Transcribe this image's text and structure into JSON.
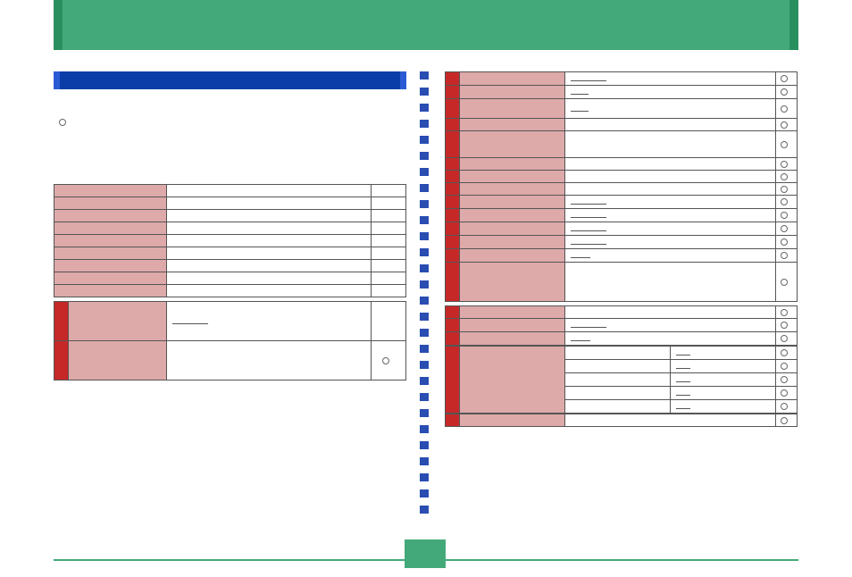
{
  "header": {
    "title": ""
  },
  "left": {
    "intro_line1": "",
    "intro_line2": "",
    "bullet_label": "",
    "footnote": "",
    "table_title": "",
    "table1": {
      "cols": [
        "",
        "",
        ""
      ],
      "rows": [
        {
          "c1": "",
          "c2": "",
          "c3": ""
        },
        {
          "c1": "",
          "c2": "",
          "c3": ""
        },
        {
          "c1": "",
          "c2": "",
          "c3": ""
        },
        {
          "c1": "",
          "c2": "",
          "c3": ""
        },
        {
          "c1": "",
          "c2": "",
          "c3": ""
        },
        {
          "c1": "",
          "c2": "",
          "c3": ""
        },
        {
          "c1": "",
          "c2": "",
          "c3": ""
        },
        {
          "c1": "",
          "c2": "",
          "c3": ""
        },
        {
          "c1": "",
          "c2": "",
          "c3": ""
        }
      ]
    },
    "table2": {
      "row_a_label": "",
      "row_a_text": "",
      "row_b_label": "",
      "row_b_text": ""
    }
  },
  "right": {
    "tall_table": {
      "rows": [
        {
          "label": "",
          "text": "",
          "has_radio": true
        },
        {
          "label": "",
          "text": "",
          "has_radio": true
        },
        {
          "label": "",
          "text": "",
          "has_radio": true
        },
        {
          "label": "",
          "text": "",
          "has_radio": true
        },
        {
          "label": "",
          "text": "",
          "has_radio": true
        },
        {
          "label": "",
          "text": "",
          "has_radio": true
        },
        {
          "label": "",
          "text": "",
          "has_radio": true
        },
        {
          "label": "",
          "text": "",
          "has_radio": true
        },
        {
          "label": "",
          "text": "",
          "has_radio": true
        },
        {
          "label": "",
          "text": "",
          "has_radio": true
        },
        {
          "label": "",
          "text": "",
          "has_radio": true
        },
        {
          "label": "",
          "text": "",
          "has_radio": true
        },
        {
          "label": "",
          "text": "",
          "has_radio": true
        },
        {
          "label": "",
          "text": "",
          "has_radio": true
        }
      ]
    },
    "lower_group": [
      {
        "label": "",
        "text": "",
        "has_radio": true
      },
      {
        "label": "",
        "text": "",
        "has_radio": true
      },
      {
        "label": "",
        "text": "",
        "has_radio": true
      }
    ],
    "split_block": {
      "left_label": "",
      "pairs": [
        {
          "l": "",
          "r": ""
        },
        {
          "l": "",
          "r": ""
        },
        {
          "l": "",
          "r": ""
        },
        {
          "l": "",
          "r": ""
        },
        {
          "l": "",
          "r": ""
        }
      ]
    }
  },
  "footer": {
    "badge": ""
  }
}
